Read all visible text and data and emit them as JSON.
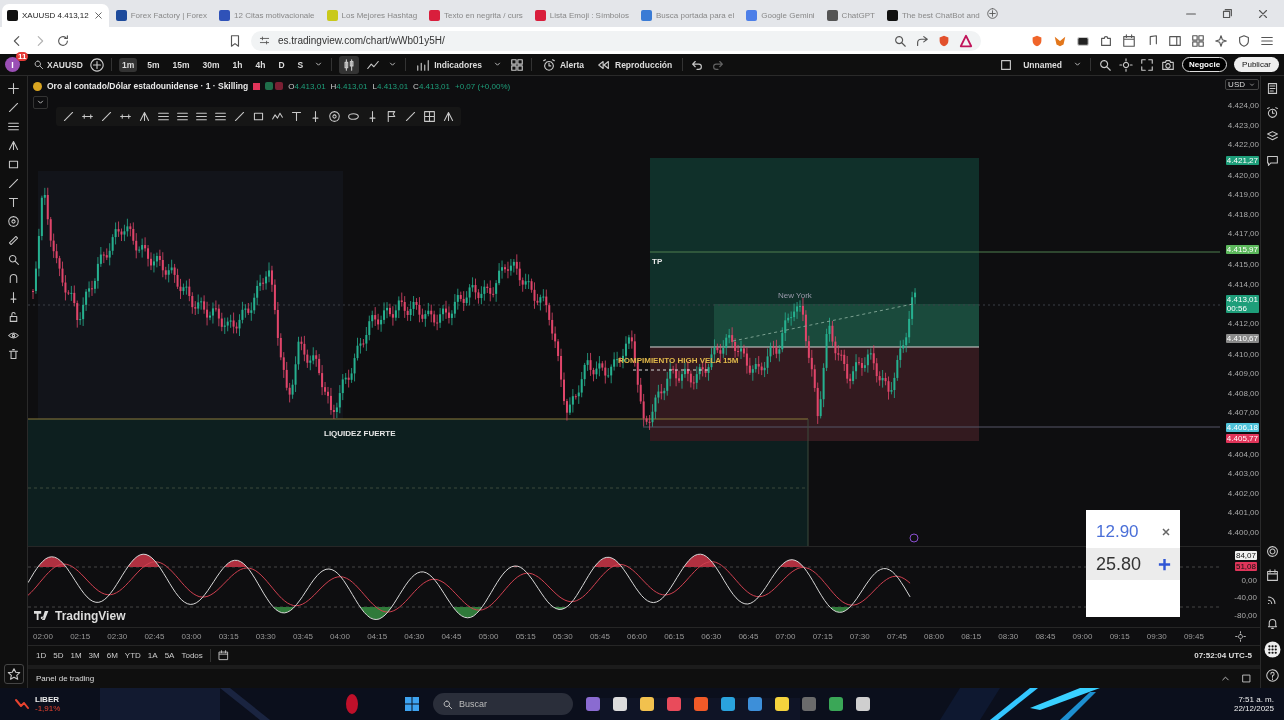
{
  "browser": {
    "tabs": [
      {
        "title": "XAUUSD 4.413,12",
        "selected": true
      },
      {
        "title": "Forex Factory | Forex",
        "selected": false
      },
      {
        "title": "12 Citas motivacionale",
        "selected": false
      },
      {
        "title": "Los Mejores Hashtag",
        "selected": false
      },
      {
        "title": "Texto en negrita / curs",
        "selected": false
      },
      {
        "title": "Lista Emoji : Símbolos",
        "selected": false
      },
      {
        "title": "Busca portada para el",
        "selected": false
      },
      {
        "title": "Google Gemini",
        "selected": false
      },
      {
        "title": "ChatGPT",
        "selected": false
      },
      {
        "title": "The best ChatBot and",
        "selected": false
      }
    ],
    "url": "es.tradingview.com/chart/wWb01y5H/"
  },
  "toolbar": {
    "avatar": "I",
    "notifications": "11",
    "symbol": "XAUUSD",
    "intervals": [
      {
        "label": "1m",
        "selected": true
      },
      {
        "label": "5m",
        "selected": false
      },
      {
        "label": "15m",
        "selected": false
      },
      {
        "label": "30m",
        "selected": false
      },
      {
        "label": "1h",
        "selected": false
      },
      {
        "label": "4h",
        "selected": false
      },
      {
        "label": "D",
        "selected": false
      },
      {
        "label": "S",
        "selected": false
      }
    ],
    "candles_selected": true,
    "indicators": "Indicadores",
    "alert": "Alerta",
    "replay": "Reproducción",
    "layout_name": "Unnamed",
    "trade_button": "Negocie",
    "publish_button": "Publicar"
  },
  "legend": {
    "title": "Oro al contado/Dólar estadounidense · 1 · Skilling",
    "ohlc": [
      {
        "label": "O",
        "value": "4.413,01"
      },
      {
        "label": "H",
        "value": "4.413,01"
      },
      {
        "label": "L",
        "value": "4.413,01"
      },
      {
        "label": "C",
        "value": "4.413,01"
      }
    ],
    "change": "+0,07 (+0,00%)"
  },
  "chart": {
    "currency": "USD",
    "price_axis": [
      {
        "kind": "tick",
        "text": "4.424,00"
      },
      {
        "kind": "tick",
        "text": "4.423,00"
      },
      {
        "kind": "tick",
        "text": "4.422,00"
      },
      {
        "kind": "badge",
        "text": "4.421,27",
        "color": "#1e9e7a"
      },
      {
        "kind": "tick",
        "text": "4.420,00"
      },
      {
        "kind": "tick",
        "text": "4.419,00"
      },
      {
        "kind": "tick",
        "text": "4.418,00"
      },
      {
        "kind": "tick",
        "text": "4.417,00"
      },
      {
        "kind": "badge",
        "text": "4.415,97",
        "color": "#5cb85c"
      },
      {
        "kind": "tick",
        "text": "4.415,00"
      },
      {
        "kind": "tick",
        "text": "4.414,00"
      },
      {
        "kind": "badge",
        "text": "4.413,01",
        "sub": "00:56",
        "color": "#1e9e7a"
      },
      {
        "kind": "tick",
        "text": "4.412,00"
      },
      {
        "kind": "badge",
        "text": "4.410,67",
        "color": "#8a8a8a"
      },
      {
        "kind": "tick",
        "text": "4.410,00"
      },
      {
        "kind": "tick",
        "text": "4.409,00"
      },
      {
        "kind": "tick",
        "text": "4.408,00"
      },
      {
        "kind": "tick",
        "text": "4.407,00"
      },
      {
        "kind": "badge",
        "text": "4.406,18",
        "color": "#4fc3d9"
      },
      {
        "kind": "badge",
        "text": "4.405,77",
        "color": "#e0355a"
      },
      {
        "kind": "tick",
        "text": "4.404,00"
      },
      {
        "kind": "tick",
        "text": "4.403,00"
      },
      {
        "kind": "tick",
        "text": "4.402,00"
      },
      {
        "kind": "tick",
        "text": "4.401,00"
      },
      {
        "kind": "tick",
        "text": "4.400,00"
      }
    ],
    "annotations": {
      "tp": "TP",
      "session": "New York",
      "breakout": "ROMPIMIENTO HIGH VELA 15M",
      "liquidity": "LIQUIDEZ FUERTE"
    },
    "oscillator_axis": [
      {
        "kind": "badge",
        "text": "84,07",
        "color": "#f0f0f0"
      },
      {
        "kind": "badge",
        "text": "51,08",
        "color": "#e0355a"
      },
      {
        "kind": "tick",
        "text": "0,00"
      },
      {
        "kind": "tick",
        "text": "-40,00"
      },
      {
        "kind": "tick",
        "text": "-80,00"
      }
    ],
    "logo": "TradingView",
    "time_axis": [
      "02:00",
      "02:15",
      "02:30",
      "02:45",
      "03:00",
      "03:15",
      "03:30",
      "03:45",
      "04:00",
      "04:15",
      "04:30",
      "04:45",
      "05:00",
      "05:15",
      "05:30",
      "05:45",
      "06:00",
      "06:15",
      "06:30",
      "06:45",
      "07:00",
      "07:15",
      "07:30",
      "07:45",
      "08:00",
      "08:15",
      "08:30",
      "08:45",
      "09:00",
      "09:15",
      "09:30",
      "09:45"
    ]
  },
  "range_bar": {
    "ranges": [
      "1D",
      "5D",
      "1M",
      "3M",
      "6M",
      "YTD",
      "1A",
      "5A",
      "Todos"
    ],
    "clock": "07:52:04 UTC-5"
  },
  "overlay": {
    "value_1": "12.90",
    "value_2": "25.80"
  },
  "panel": "Panel de trading",
  "taskbar": {
    "ticker": "LIBER",
    "ticker_change": "-1,91%",
    "search_placeholder": "Buscar",
    "time": "7:51 a. m.",
    "date": "22/12/2025"
  }
}
